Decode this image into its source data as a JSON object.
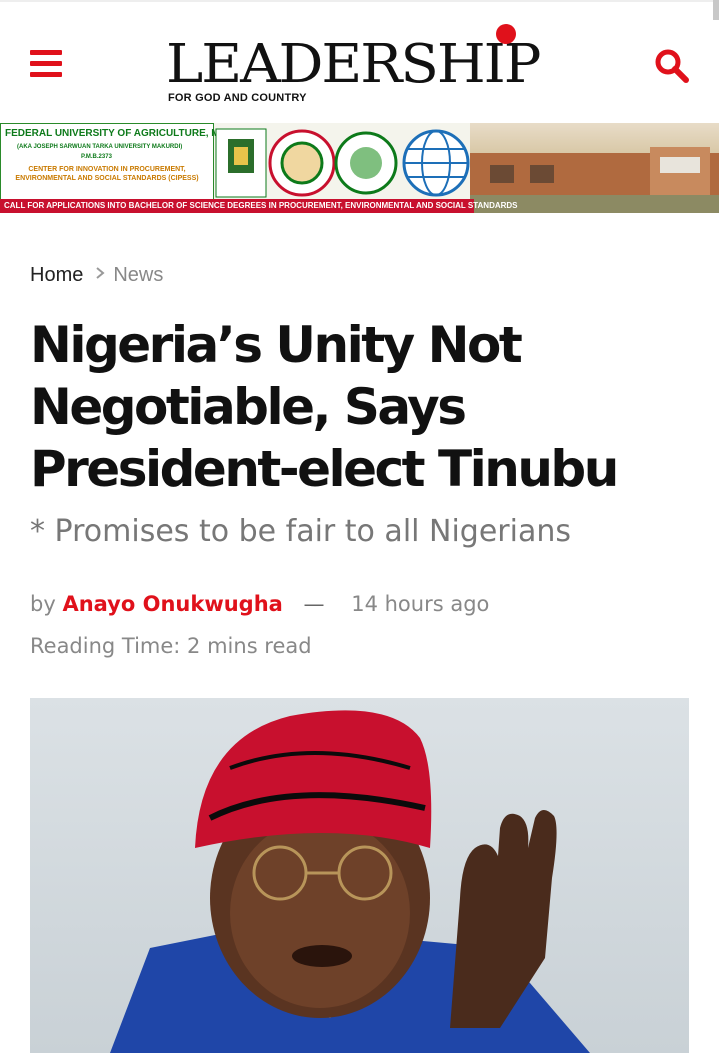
{
  "header": {
    "menu_icon": "hamburger-menu-icon",
    "search_icon": "search-icon",
    "logo": {
      "wordmark": "LEADERSHIP",
      "tagline": "FOR GOD AND COUNTRY"
    }
  },
  "banner": {
    "institution": "FEDERAL UNIVERSITY OF AGRICULTURE, MAKURDI",
    "aka": "(AKA JOSEPH SARWUAN TARKA UNIVERSITY MAKURDI)",
    "pmb": "P.M.B.2373",
    "center": "CENTER FOR INNOVATION IN PROCUREMENT, ENVIRONMENTAL AND SOCIAL STANDARDS (CIPESS)",
    "call": "CALL FOR APPLICATIONS INTO BACHELOR OF SCIENCE DEGREES IN PROCUREMENT, ENVIRONMENTAL AND SOCIAL STANDARDS"
  },
  "breadcrumb": {
    "home": "Home",
    "current": "News"
  },
  "article": {
    "title": "Nigeria’s Unity Not Negotiable, Says President-elect Tinubu",
    "subtitle": "* Promises to be fair to all Nigerians",
    "by": "by",
    "author": "Anayo Onukwugha",
    "separator": "—",
    "time": "14 hours ago",
    "reading_time": "Reading Time: 2 mins read"
  },
  "colors": {
    "brand_red": "#e0111b",
    "text_dark": "#111111",
    "text_muted": "#888888"
  }
}
